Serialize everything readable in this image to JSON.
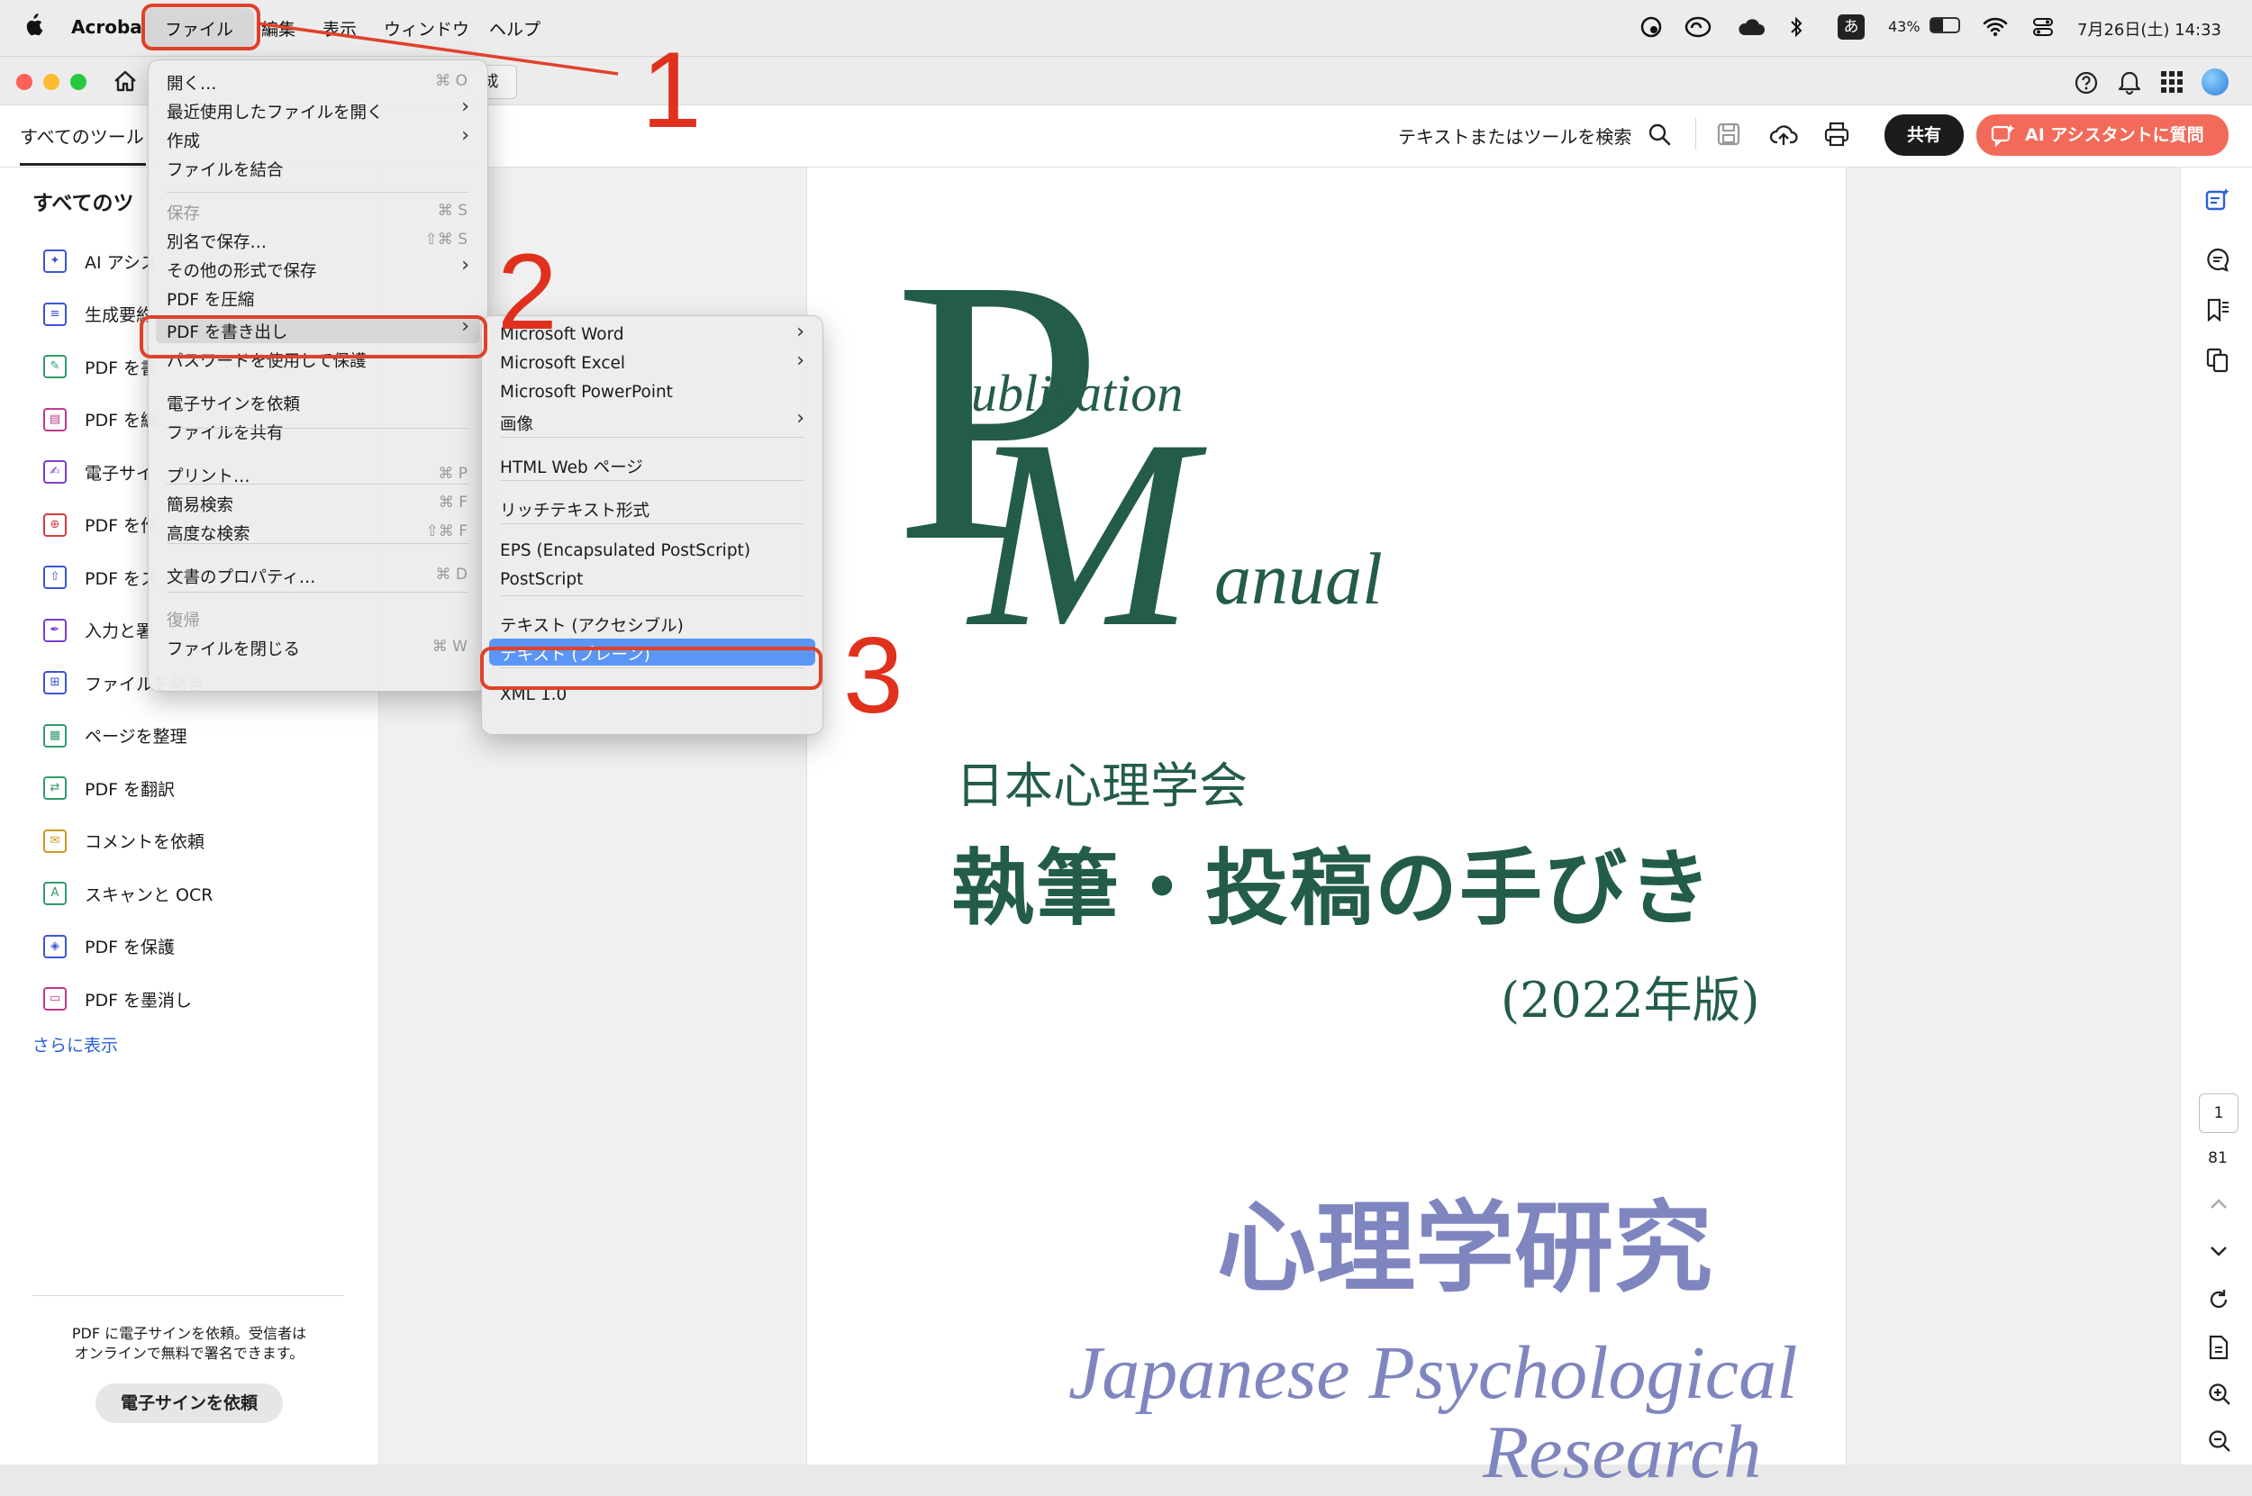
{
  "menubar": {
    "app": "Acrobat",
    "items": [
      "ファイル",
      "編集",
      "表示",
      "ウィンドウ",
      "ヘルプ"
    ],
    "battery": "43%",
    "ime": "あ",
    "clock": "7月26日(土) 14:33"
  },
  "titlebar": {
    "tab_fragment": "成"
  },
  "toolbar": {
    "all_tools_tab": "すべてのツール",
    "search_label": "テキストまたはツールを検索",
    "share_button": "共有",
    "ai_button": "AI アシスタントに質問"
  },
  "left_panel": {
    "heading": "すべてのツ",
    "tools": [
      {
        "label": "AI アシス",
        "color": "#3a56d4"
      },
      {
        "label": "生成要約",
        "color": "#3a56d4"
      },
      {
        "label": "PDF を書",
        "color": "#2f9d6a"
      },
      {
        "label": "PDF を編",
        "color": "#c2388f"
      },
      {
        "label": "電子サイ",
        "color": "#7a3ed1"
      },
      {
        "label": "PDF を作",
        "color": "#d23b3b"
      },
      {
        "label": "PDF をス",
        "color": "#3a56d4"
      },
      {
        "label": "入力と署",
        "color": "#7a3ed1"
      },
      {
        "label": "ファイルを結合",
        "color": "#3a56d4"
      },
      {
        "label": "ページを整理",
        "color": "#2f9d6a"
      },
      {
        "label": "PDF を翻訳",
        "color": "#2f9d6a"
      },
      {
        "label": "コメントを依頼",
        "color": "#c99a1e"
      },
      {
        "label": "スキャンと OCR",
        "color": "#2f9d6a"
      },
      {
        "label": "PDF を保護",
        "color": "#3a56d4"
      },
      {
        "label": "PDF を墨消し",
        "color": "#c2388f"
      }
    ],
    "show_more": "さらに表示",
    "promo_text_1": "PDF に電子サインを依頼。受信者は",
    "promo_text_2": "オンラインで無料で署名できます。",
    "promo_button": "電子サインを依頼"
  },
  "file_menu": {
    "items": [
      {
        "label": "開く…",
        "shortcut": "⌘ O"
      },
      {
        "label": "最近使用したファイルを開く",
        "submenu": true
      },
      {
        "label": "作成",
        "submenu": true
      },
      {
        "label": "ファイルを結合"
      },
      {
        "label": "保存",
        "shortcut": "⌘ S",
        "disabled": true
      },
      {
        "label": "別名で保存…",
        "shortcut": "⇧⌘ S"
      },
      {
        "label": "その他の形式で保存",
        "submenu": true
      },
      {
        "label": "PDF を圧縮"
      },
      {
        "label": "PDF を書き出し",
        "submenu": true,
        "highlighted": true
      },
      {
        "label": "パスワードを使用して保護"
      },
      {
        "label": "電子サインを依頼"
      },
      {
        "label": "ファイルを共有"
      },
      {
        "label": "プリント…",
        "shortcut": "⌘ P"
      },
      {
        "label": "簡易検索",
        "shortcut": "⌘ F"
      },
      {
        "label": "高度な検索",
        "shortcut": "⇧⌘ F"
      },
      {
        "label": "文書のプロパティ…",
        "shortcut": "⌘ D"
      },
      {
        "label": "復帰",
        "disabled": true
      },
      {
        "label": "ファイルを閉じる",
        "shortcut": "⌘ W"
      }
    ]
  },
  "export_submenu": {
    "items": [
      {
        "label": "Microsoft Word",
        "submenu": true
      },
      {
        "label": "Microsoft Excel",
        "submenu": true
      },
      {
        "label": "Microsoft PowerPoint"
      },
      {
        "label": "画像",
        "submenu": true
      },
      {
        "label": "HTML Web ページ"
      },
      {
        "label": "リッチテキスト形式"
      },
      {
        "label": "EPS (Encapsulated PostScript)"
      },
      {
        "label": "PostScript"
      },
      {
        "label": "テキスト (アクセシブル)"
      },
      {
        "label": "テキスト (プレーン)",
        "selected": true
      },
      {
        "label": "XML 1.0"
      }
    ]
  },
  "steps": [
    "1",
    "2",
    "3"
  ],
  "document": {
    "logo_P": "P",
    "logo_ublication": "ublication",
    "logo_M": "M",
    "logo_anual": "anual",
    "society": "日本心理学会",
    "title": "執筆・投稿の手びき",
    "edition": "(2022年版)",
    "journal_jp": "心理学研究",
    "journal_en_1": "Japanese Psychological",
    "journal_en_2": "Research",
    "green": "#235c4a",
    "purple": "#7f86bf"
  },
  "page_nav": {
    "current": "1",
    "total": "81"
  },
  "colors": {
    "accent_red": "#e0412a",
    "highlight_blue": "#5b95f7",
    "ai_button": "#f26a5a"
  }
}
